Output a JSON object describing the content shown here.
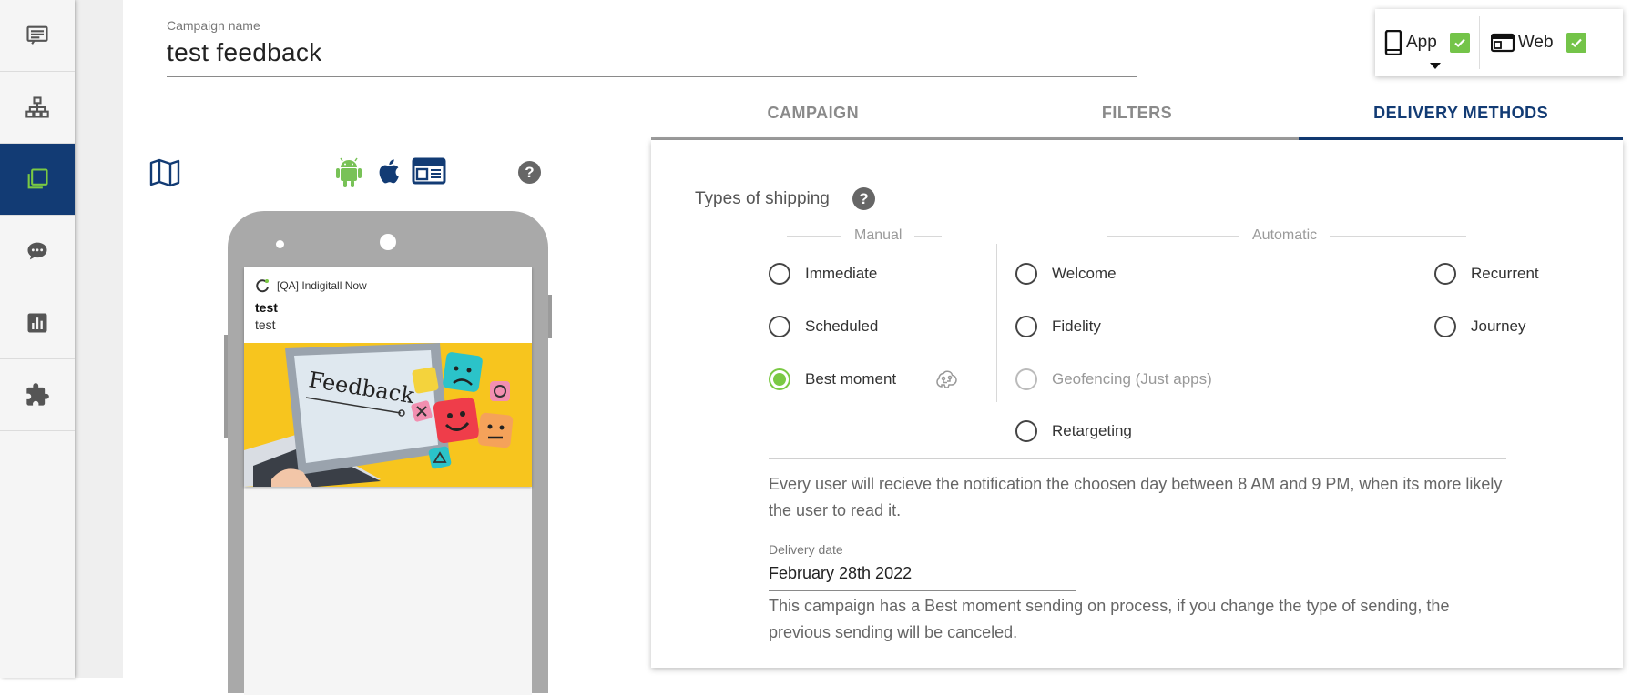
{
  "sidebar": {
    "items": [
      {
        "name": "campaigns",
        "icon": "message-list-icon",
        "active": false
      },
      {
        "name": "segments",
        "icon": "sitemap-icon",
        "active": false
      },
      {
        "name": "inbox",
        "icon": "copy-stack-icon",
        "active": true
      },
      {
        "name": "chat",
        "icon": "chat-bubble-icon",
        "active": false
      },
      {
        "name": "analytics",
        "icon": "bar-chart-icon",
        "active": false
      },
      {
        "name": "integrations",
        "icon": "puzzle-icon",
        "active": false
      }
    ]
  },
  "campaign": {
    "name_label": "Campaign name",
    "name_value": "test feedback"
  },
  "channels": {
    "app_label": "App",
    "web_label": "Web",
    "app_checked": true,
    "web_checked": true
  },
  "tabs": [
    {
      "label": "CAMPAIGN",
      "active": false
    },
    {
      "label": "FILTERS",
      "active": false
    },
    {
      "label": "DELIVERY METHODS",
      "active": true
    }
  ],
  "shipping": {
    "title": "Types of shipping",
    "help_glyph": "?",
    "manual_heading": "Manual",
    "automatic_heading": "Automatic",
    "options": {
      "immediate": "Immediate",
      "scheduled": "Scheduled",
      "best_moment": "Best moment",
      "welcome": "Welcome",
      "fidelity": "Fidelity",
      "geofencing": "Geofencing (Just apps)",
      "retargeting": "Retargeting",
      "recurrent": "Recurrent",
      "journey": "Journey"
    },
    "selected": "best_moment",
    "disabled": [
      "geofencing"
    ],
    "description": "Every user will recieve the notification the choosen day between 8 AM and 9 PM, when its more likely the user to read it.",
    "delivery_date_label": "Delivery date",
    "delivery_date_value": "February 28th 2022",
    "warning": "This campaign has a Best moment sending on process, if you change the type of sending, the previous sending will be canceled."
  },
  "preview": {
    "help_glyph": "?",
    "platforms": [
      "android-icon",
      "apple-icon",
      "browser-window-icon"
    ],
    "notification": {
      "app_name": "[QA] Indigitall Now",
      "title": "test",
      "body": "test",
      "image_caption": "Feedback"
    }
  },
  "colors": {
    "primary": "#123b74",
    "accent_green": "#7ac943",
    "checkbox_green": "#74c449",
    "android_green": "#78c257"
  }
}
